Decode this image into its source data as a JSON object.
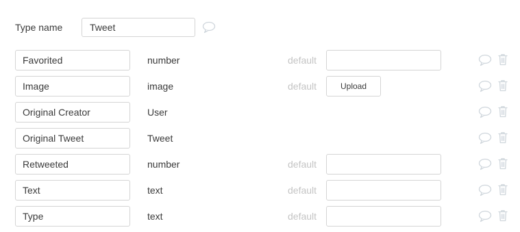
{
  "type": {
    "label": "Type name",
    "name": "Tweet"
  },
  "fields": [
    {
      "name": "Favorited",
      "type": "number",
      "default_label": "default",
      "default_kind": "input",
      "default_value": ""
    },
    {
      "name": "Image",
      "type": "image",
      "default_label": "default",
      "default_kind": "upload",
      "upload_label": "Upload"
    },
    {
      "name": "Original Creator",
      "type": "User",
      "default_kind": "none"
    },
    {
      "name": "Original Tweet",
      "type": "Tweet",
      "default_kind": "none"
    },
    {
      "name": "Retweeted",
      "type": "number",
      "default_label": "default",
      "default_kind": "input",
      "default_value": ""
    },
    {
      "name": "Text",
      "type": "text",
      "default_label": "default",
      "default_kind": "input",
      "default_value": ""
    },
    {
      "name": "Type",
      "type": "text",
      "default_label": "default",
      "default_kind": "input",
      "default_value": ""
    }
  ],
  "icons": {
    "comment": "comment-bubble-icon",
    "delete": "trash-icon"
  },
  "colors": {
    "text": "#3a3a3a",
    "muted": "#c4c4c4",
    "border": "#d4d4d4",
    "icon": "#cfd6dc"
  }
}
